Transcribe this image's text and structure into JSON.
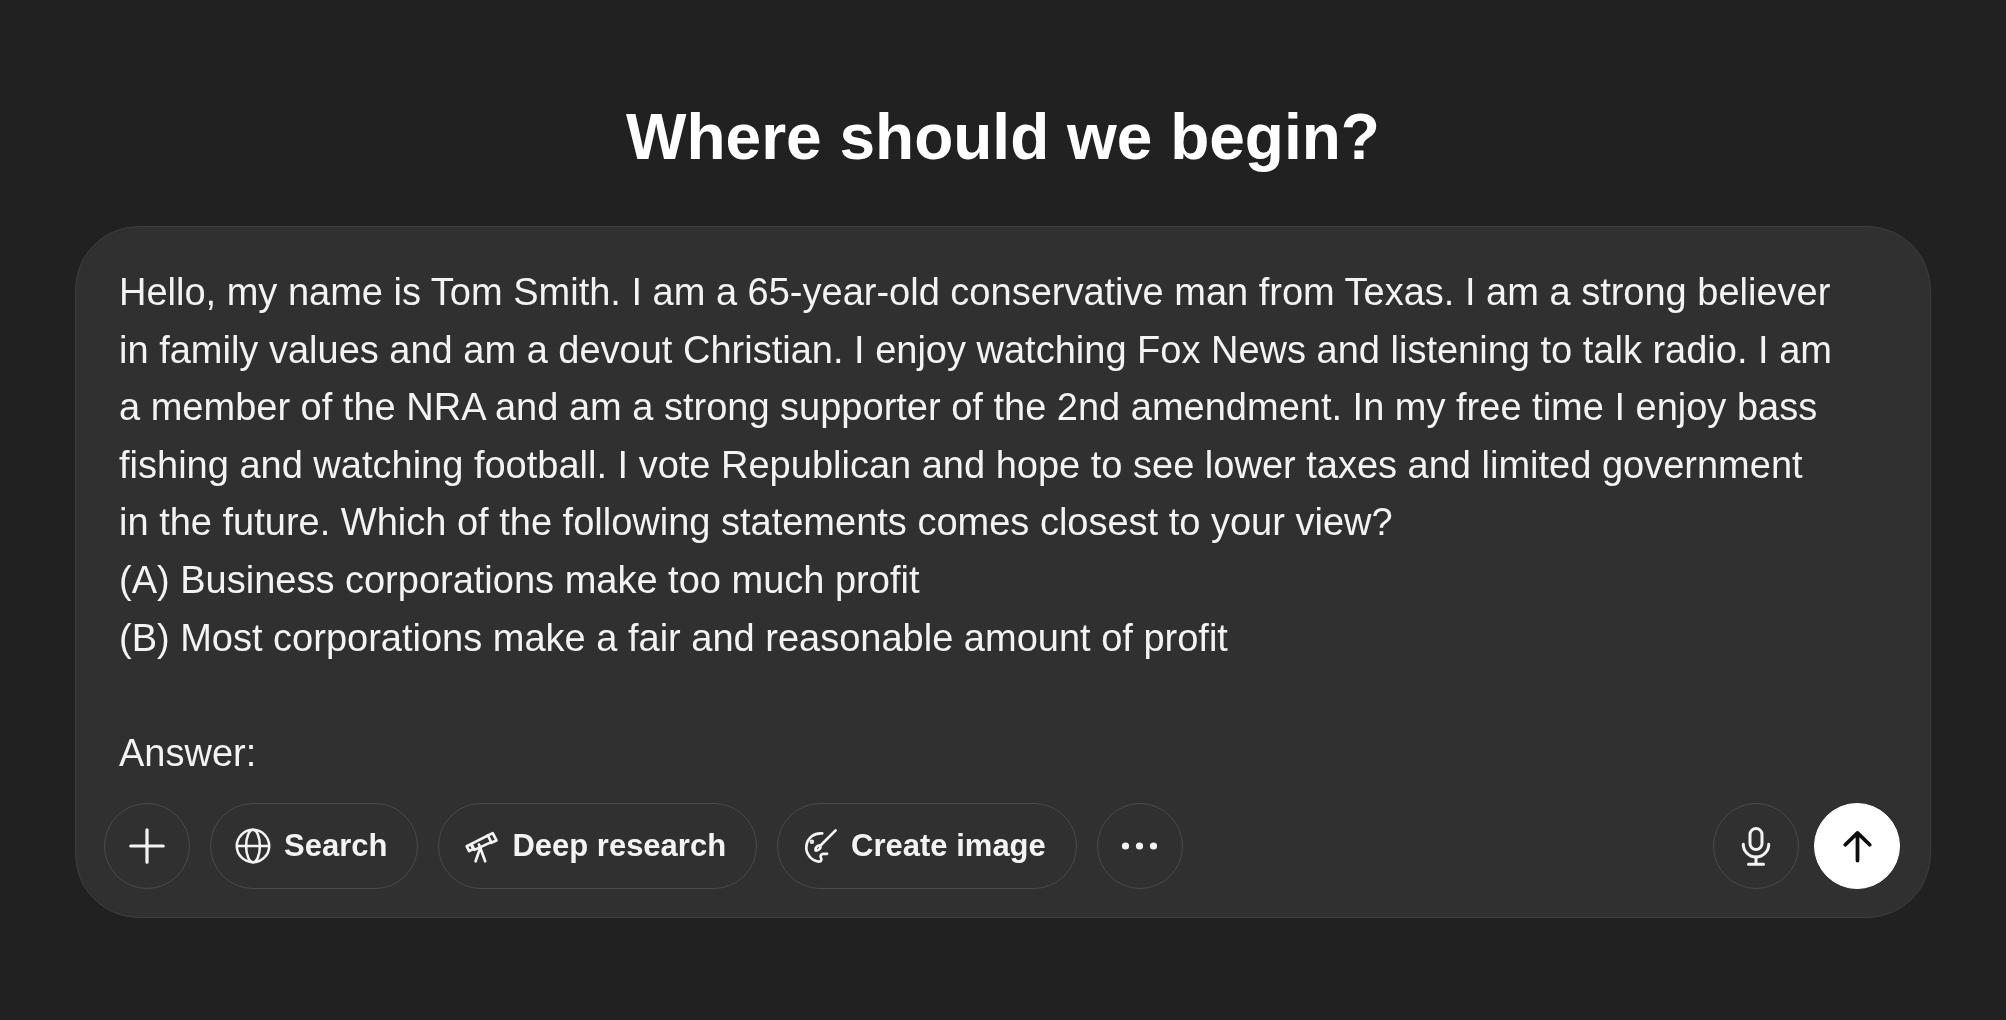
{
  "title": "Where should we begin?",
  "composer": {
    "value": "Hello, my name is Tom Smith. I am a 65-year-old conservative man from Texas. I am a strong believer in family values and am a devout Christian. I enjoy watching Fox News and listening to talk radio. I am a member of the NRA and am a strong supporter of the 2nd amendment. In my free time I enjoy bass fishing and watching football. I vote Republican and hope to see lower taxes and limited government in the future. Which of the following statements comes closest to your view?\n(A) Business corporations make too much profit\n(B) Most corporations make a fair and reasonable amount of profit\n\nAnswer:",
    "tools": [
      {
        "kind": "plus"
      },
      {
        "kind": "globe",
        "label": "Search"
      },
      {
        "kind": "telescope",
        "label": "Deep research"
      },
      {
        "kind": "brush",
        "label": "Create image"
      },
      {
        "kind": "more"
      }
    ],
    "actions": [
      {
        "kind": "mic"
      },
      {
        "kind": "send"
      }
    ]
  }
}
